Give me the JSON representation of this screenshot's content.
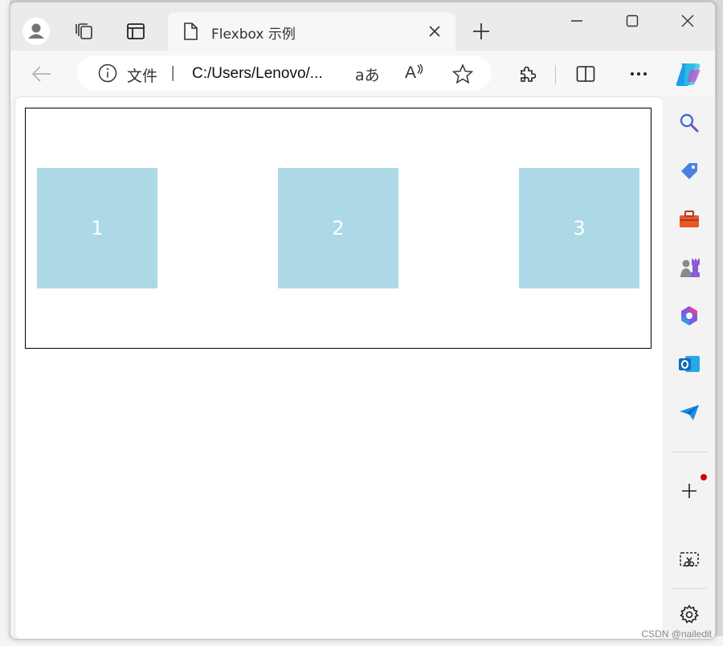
{
  "browser": {
    "tab": {
      "title": "Flexbox 示例"
    },
    "address": {
      "security_label": "文件",
      "separator": "|",
      "url": "C:/Users/Lenovo/..."
    },
    "read_mode_label": "aあ",
    "read_aloud_label": "A"
  },
  "page": {
    "flex_items": [
      "1",
      "2",
      "3"
    ],
    "colors": {
      "item_background": "#add8e6",
      "item_text": "#ffffff",
      "container_border": "#000000"
    }
  },
  "sidebar": {
    "icons": [
      "search-icon",
      "tag-icon",
      "toolbox-icon",
      "chess-icon",
      "copilot-icon",
      "outlook-icon",
      "send-icon",
      "add-icon",
      "screenshot-icon",
      "settings-icon"
    ],
    "notification_dot_color": "#d40000"
  },
  "watermark": "CSDN @nailedit"
}
